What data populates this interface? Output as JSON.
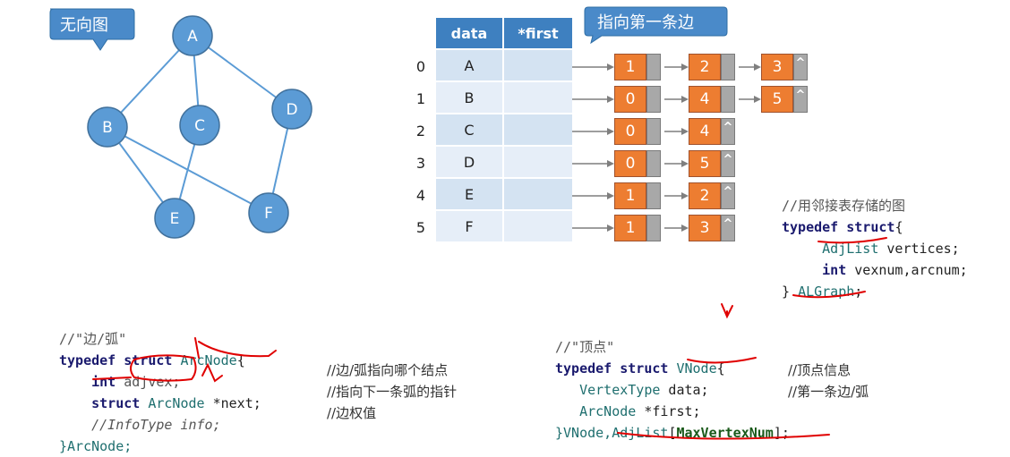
{
  "graph": {
    "callout": "无向图",
    "nodes": [
      "A",
      "B",
      "C",
      "D",
      "E",
      "F"
    ],
    "edges": [
      [
        "A",
        "B"
      ],
      [
        "A",
        "C"
      ],
      [
        "A",
        "D"
      ],
      [
        "B",
        "E"
      ],
      [
        "B",
        "F"
      ],
      [
        "C",
        "E"
      ],
      [
        "D",
        "F"
      ]
    ]
  },
  "table": {
    "headers": [
      "data",
      "*first"
    ],
    "callout": "指向第一条边",
    "rows": [
      {
        "index": "0",
        "data": "A",
        "arcs": [
          [
            "1",
            ""
          ],
          [
            "2",
            ""
          ],
          [
            "3",
            "^"
          ]
        ]
      },
      {
        "index": "1",
        "data": "B",
        "arcs": [
          [
            "0",
            ""
          ],
          [
            "4",
            ""
          ],
          [
            "5",
            "^"
          ]
        ]
      },
      {
        "index": "2",
        "data": "C",
        "arcs": [
          [
            "0",
            ""
          ],
          [
            "4",
            "^"
          ]
        ]
      },
      {
        "index": "3",
        "data": "D",
        "arcs": [
          [
            "0",
            ""
          ],
          [
            "5",
            "^"
          ]
        ]
      },
      {
        "index": "4",
        "data": "E",
        "arcs": [
          [
            "1",
            ""
          ],
          [
            "2",
            "^"
          ]
        ]
      },
      {
        "index": "5",
        "data": "F",
        "arcs": [
          [
            "1",
            ""
          ],
          [
            "3",
            "^"
          ]
        ]
      }
    ]
  },
  "code": {
    "algraph": {
      "comment": "//用邻接表存储的图",
      "l1_kw": "typedef struct",
      "l1_brace": "{",
      "l2_type": "AdjList",
      "l2_rest": " vertices;",
      "l3_kw": "int",
      "l3_rest": " vexnum,arcnum;",
      "l4_open": "} ",
      "l4_name": "ALGraph",
      "l4_end": ";"
    },
    "arcnode": {
      "comment": "//\"边/弧\"",
      "l1_kw": "typedef struct",
      "l1_name": "ArcNode",
      "l1_brace": "{",
      "l2_kw": "int",
      "l2_rest": " adjvex;",
      "l2_comment": "//边/弧指向哪个结点",
      "l3_kw": "struct",
      "l3_type": "ArcNode",
      "l3_rest": " *next;",
      "l3_comment": "//指向下一条弧的指针",
      "l4_text": "//InfoType info;",
      "l4_comment": "//边权值",
      "l5_text": "}ArcNode;"
    },
    "vnode": {
      "comment": "//\"顶点\"",
      "l1_kw": "typedef struct",
      "l1_name": "VNode",
      "l1_brace": "{",
      "l2_type": "VertexType",
      "l2_rest": " data;",
      "l2_comment": "//顶点信息",
      "l3_type": "ArcNode",
      "l3_rest": " *first;",
      "l3_comment": "//第一条边/弧",
      "l4_a": "}VNode,",
      "l4_b": "AdjList",
      "l4_c": "[",
      "l4_d": "MaxVertexNum",
      "l4_e": "];"
    }
  },
  "colors": {
    "node_fill": "#5b9bd5",
    "node_stroke": "#41719c",
    "arc_fill": "#ed7d31",
    "ptr_fill": "#a8a8a8",
    "table_head": "#3e80c0",
    "annotation": "#e00000"
  }
}
